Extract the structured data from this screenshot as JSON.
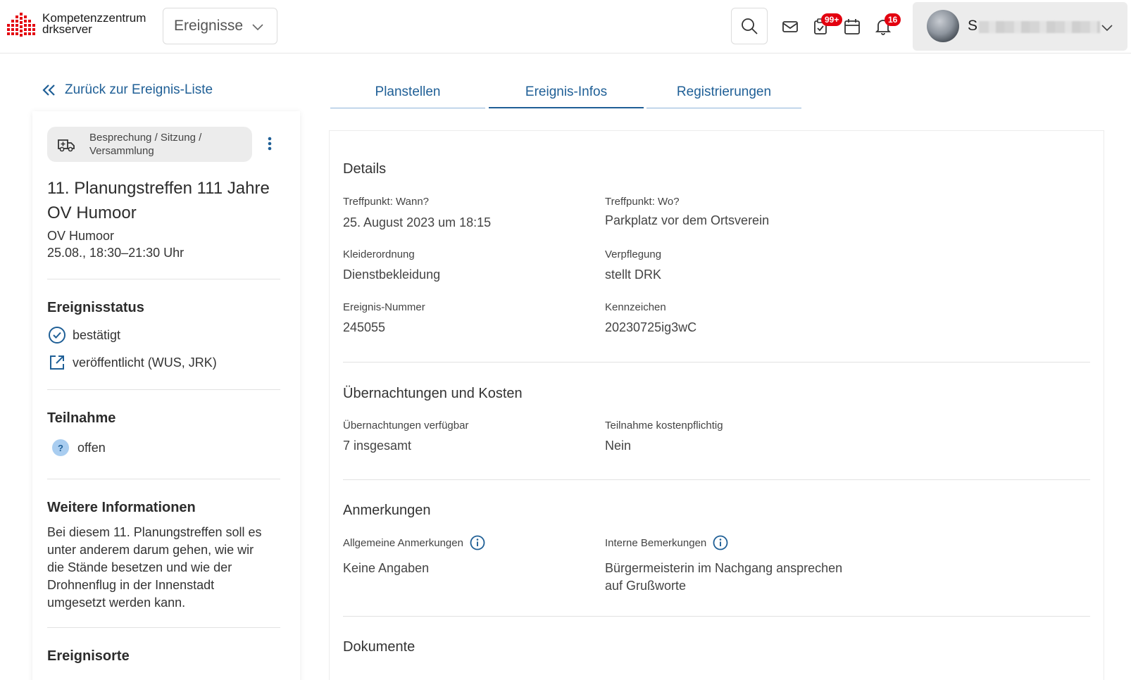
{
  "header": {
    "logo_line1": "Kompetenzzentrum",
    "logo_line2": "drkserver",
    "logo_color": "#e3000f",
    "nav_select": "Ereignisse",
    "icons": [
      "search-icon",
      "mail-icon",
      "task-check-icon",
      "calendar-icon",
      "bell-icon"
    ],
    "tasks_badge": "99+",
    "notifications_badge": "16",
    "user_initial": "S"
  },
  "sidebar": {
    "back_label": "Zurück zur Ereignis-Liste",
    "category": "Besprechung / Sitzung / Versammlung",
    "title": "11. Planungstreffen 111 Jahre OV Humoor",
    "organization": "OV Humoor",
    "date": "25.08., 18:30–21:30 Uhr",
    "status_heading": "Ereignisstatus",
    "status_confirmed": "bestätigt",
    "status_published": "veröffentlicht (WUS, JRK)",
    "participation_heading": "Teilnahme",
    "participation_value": "offen",
    "more_heading": "Weitere Informationen",
    "more_text": "Bei diesem 11. Planungstreffen soll es unter anderem darum gehen, wie wir die Stände besetzen und wie der Drohnenflug in der Innenstadt umgesetzt werden kann.",
    "locations_heading": "Ereignisorte"
  },
  "tabs": [
    {
      "label": "Planstellen",
      "active": false
    },
    {
      "label": "Ereignis-Infos",
      "active": true
    },
    {
      "label": "Registrierungen",
      "active": false
    }
  ],
  "main": {
    "details_heading": "Details",
    "when_label": "Treffpunkt: Wann?",
    "when_value": "25. August 2023 um 18:15",
    "where_label": "Treffpunkt: Wo?",
    "where_value": "Parkplatz vor dem Ortsverein",
    "dress_label": "Kleiderordnung",
    "dress_value": "Dienstbekleidung",
    "food_label": "Verpflegung",
    "food_value": "stellt DRK",
    "number_label": "Ereignis-Nummer",
    "number_value": "245055",
    "tag_label": "Kennzeichen",
    "tag_value": "20230725ig3wC",
    "overnight_heading": "Übernachtungen und Kosten",
    "overnight_label": "Übernachtungen verfügbar",
    "overnight_value": "7 insgesamt",
    "cost_label": "Teilnahme kostenpflichtig",
    "cost_value": "Nein",
    "notes_heading": "Anmerkungen",
    "general_notes_label": "Allgemeine Anmerkungen",
    "general_notes_value": "Keine Angaben",
    "internal_notes_label": "Interne Bemerkungen",
    "internal_notes_value_1": "Bürgermeisterin im Nachgang ansprechen",
    "internal_notes_value_2": "auf Grußworte",
    "documents_heading": "Dokumente"
  },
  "colors": {
    "accent": "#1f5f96",
    "badge": "#e3000f",
    "pill_bg": "#ececec"
  }
}
